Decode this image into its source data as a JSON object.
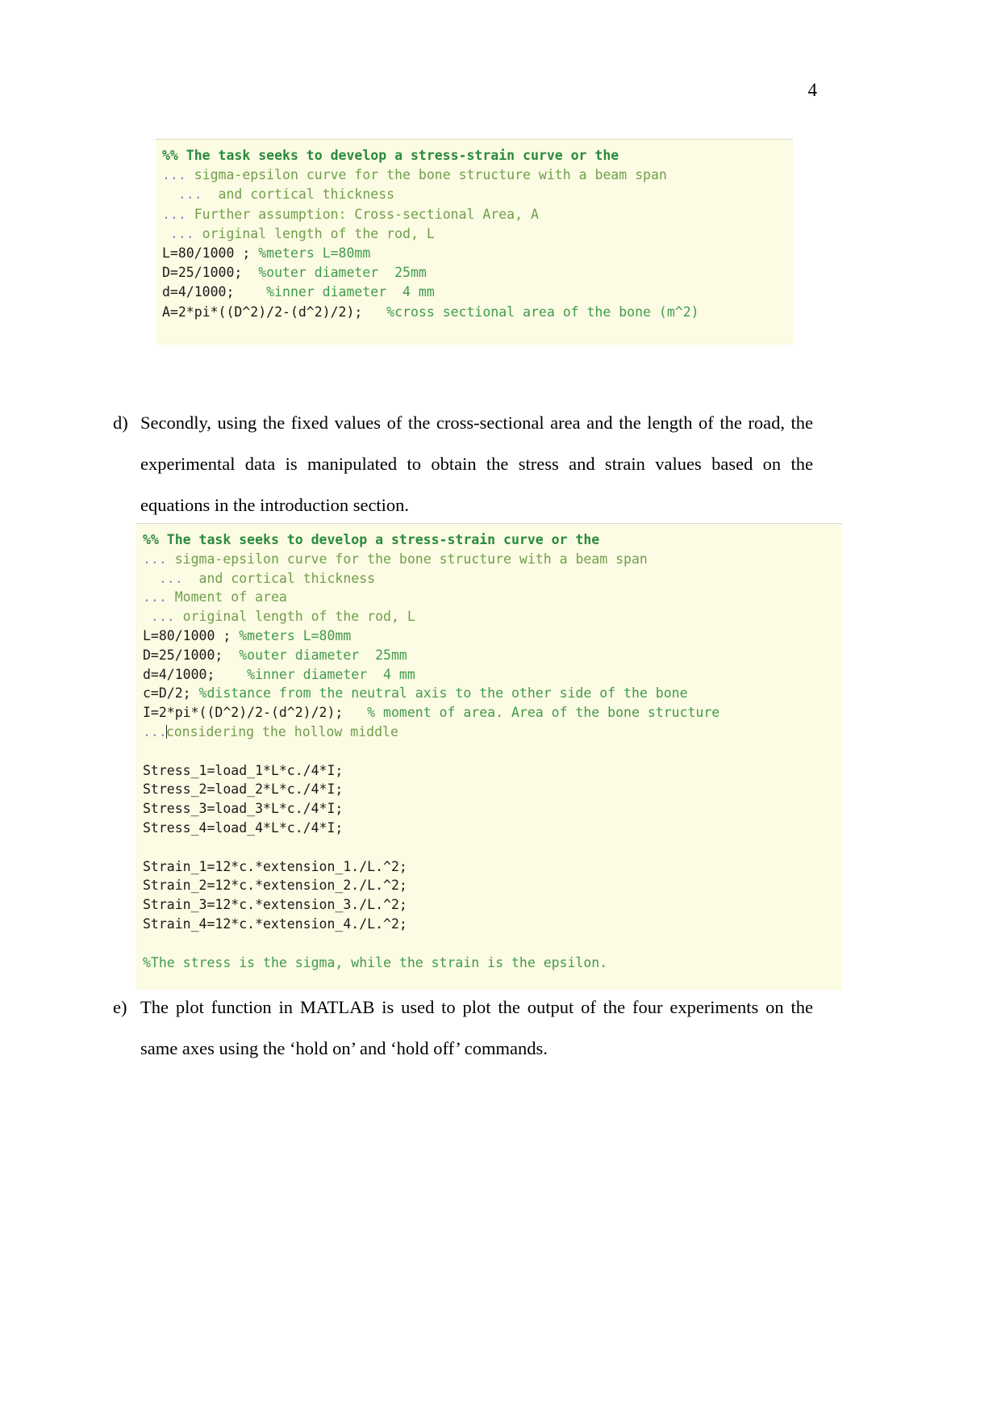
{
  "page": {
    "number": "4"
  },
  "code_block_1": {
    "lines": [
      [
        {
          "t": "cell",
          "s": "%% The task seeks to develop a stress-strain curve or the"
        }
      ],
      [
        {
          "t": "cont",
          "s": "... "
        },
        {
          "t": "comment-d",
          "s": "sigma-epsilon curve for the bone structure with a beam span"
        }
      ],
      [
        {
          "t": "cont",
          "s": "  ... "
        },
        {
          "t": "comment-d",
          "s": " and cortical thickness"
        }
      ],
      [
        {
          "t": "cont",
          "s": "... "
        },
        {
          "t": "comment-d",
          "s": "Further assumption: Cross-sectional Area, A"
        }
      ],
      [
        {
          "t": "cont",
          "s": " ... "
        },
        {
          "t": "comment-d",
          "s": "original length of the rod, L"
        }
      ],
      [
        {
          "t": "code",
          "s": "L=80/1000 ; "
        },
        {
          "t": "comment",
          "s": "%meters L=80mm"
        }
      ],
      [
        {
          "t": "code",
          "s": "D=25/1000; "
        },
        {
          "t": "comment",
          "s": " %outer diameter  25mm"
        }
      ],
      [
        {
          "t": "code",
          "s": "d=4/1000;  "
        },
        {
          "t": "comment",
          "s": "  %inner diameter  4 mm"
        }
      ],
      [
        {
          "t": "code",
          "s": "A=2*pi*((D^2)/2-(d^2)/2);  "
        },
        {
          "t": "comment",
          "s": " %cross sectional area of the bone (m^2)"
        }
      ]
    ]
  },
  "paragraph_d": {
    "marker": "d)",
    "text": "Secondly, using the fixed values of the cross-sectional area and the length of the road, the experimental data is manipulated to obtain the stress and strain values based on the equations in the introduction section."
  },
  "code_block_2": {
    "lines": [
      [
        {
          "t": "cell",
          "s": "%% The task seeks to develop a stress-strain curve or the"
        }
      ],
      [
        {
          "t": "cont",
          "s": "... "
        },
        {
          "t": "comment-d",
          "s": "sigma-epsilon curve for the bone structure with a beam span"
        }
      ],
      [
        {
          "t": "cont",
          "s": "  ... "
        },
        {
          "t": "comment-d",
          "s": " and cortical thickness"
        }
      ],
      [
        {
          "t": "cont",
          "s": "... "
        },
        {
          "t": "comment-d",
          "s": "Moment of area"
        }
      ],
      [
        {
          "t": "cont",
          "s": " ... "
        },
        {
          "t": "comment-d",
          "s": "original length of the rod, L"
        }
      ],
      [
        {
          "t": "code",
          "s": "L=80/1000 ; "
        },
        {
          "t": "comment",
          "s": "%meters L=80mm"
        }
      ],
      [
        {
          "t": "code",
          "s": "D=25/1000; "
        },
        {
          "t": "comment",
          "s": " %outer diameter  25mm"
        }
      ],
      [
        {
          "t": "code",
          "s": "d=4/1000;  "
        },
        {
          "t": "comment",
          "s": "  %inner diameter  4 mm"
        }
      ],
      [
        {
          "t": "code",
          "s": "c=D/2; "
        },
        {
          "t": "comment",
          "s": "%distance from the neutral axis to the other side of the bone"
        }
      ],
      [
        {
          "t": "code",
          "s": "I=2*pi*((D^2)/2-(d^2)/2);  "
        },
        {
          "t": "comment",
          "s": " % moment of area. Area of the bone structure"
        }
      ],
      [
        {
          "t": "cont",
          "s": "..."
        },
        {
          "t": "caret",
          "s": ""
        },
        {
          "t": "comment-d",
          "s": "considering the hollow middle"
        }
      ],
      [
        {
          "t": "code",
          "s": ""
        }
      ],
      [
        {
          "t": "code",
          "s": "Stress_1=load_1*L*c./4*I;"
        }
      ],
      [
        {
          "t": "code",
          "s": "Stress_2=load_2*L*c./4*I;"
        }
      ],
      [
        {
          "t": "code",
          "s": "Stress_3=load_3*L*c./4*I;"
        }
      ],
      [
        {
          "t": "code",
          "s": "Stress_4=load_4*L*c./4*I;"
        }
      ],
      [
        {
          "t": "code",
          "s": ""
        }
      ],
      [
        {
          "t": "code",
          "s": "Strain_1=12*c.*extension_1./L.^2;"
        }
      ],
      [
        {
          "t": "code",
          "s": "Strain_2=12*c.*extension_2./L.^2;"
        }
      ],
      [
        {
          "t": "code",
          "s": "Strain_3=12*c.*extension_3./L.^2;"
        }
      ],
      [
        {
          "t": "code",
          "s": "Strain_4=12*c.*extension_4./L.^2;"
        }
      ],
      [
        {
          "t": "code",
          "s": ""
        }
      ],
      [
        {
          "t": "comment",
          "s": "%The stress is the sigma, while the strain is the epsilon."
        }
      ]
    ]
  },
  "paragraph_e": {
    "marker": "e)",
    "text": "The plot function in MATLAB is used to plot the output of the four experiments on the same axes using the ‘hold on’ and ‘hold off’ commands."
  },
  "colors": {
    "code_background": "#fcfbe3",
    "cell_header": "#2a8a3e",
    "comment": "#3f9b4e",
    "comment_faint": "#6f9f4c",
    "continuation": "#7d8cc4",
    "code_text": "#1a1a1a",
    "page_background": "#ffffff"
  }
}
